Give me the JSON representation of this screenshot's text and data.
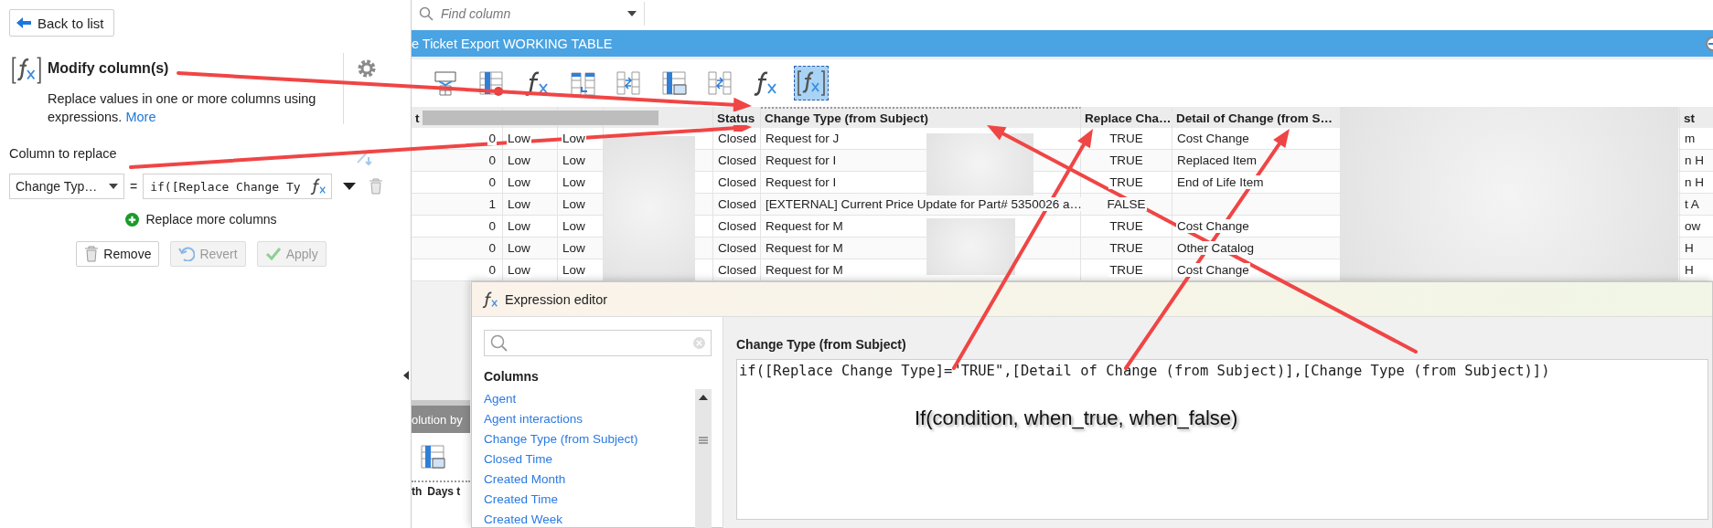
{
  "left_panel": {
    "back_button": "Back to list",
    "title": "Modify column(s)",
    "description": "Replace values in one or more columns using expressions.",
    "more_link": "More",
    "column_label": "Column to replace",
    "column_select": "Change Typ…",
    "equals": "=",
    "expression_value": "if([Replace Change Ty",
    "add_link": "Replace more columns",
    "buttons": [
      {
        "kind": "remove",
        "label": "Remove",
        "disabled": false
      },
      {
        "kind": "revert",
        "label": "Revert",
        "disabled": true
      },
      {
        "kind": "apply",
        "label": "Apply",
        "disabled": true
      }
    ]
  },
  "find_column": {
    "placeholder": "Find column"
  },
  "table_title": "e Ticket Export WORKING TABLE",
  "toolbar": [
    {
      "kind": "ab",
      "selected": false
    },
    {
      "kind": "column-remove",
      "selected": false
    },
    {
      "kind": "fx",
      "selected": false
    },
    {
      "kind": "columns-move",
      "selected": false
    },
    {
      "kind": "split",
      "selected": false
    },
    {
      "kind": "table-window",
      "selected": false
    },
    {
      "kind": "split",
      "selected": false
    },
    {
      "kind": "fx",
      "selected": false
    },
    {
      "kind": "bracket-fx",
      "selected": true
    }
  ],
  "table": {
    "columns": [
      {
        "label": "t",
        "highlighted": false
      },
      {
        "highlighted": false
      },
      {
        "highlighted": false
      },
      {
        "highlighted": false
      },
      {
        "label": "Status",
        "highlighted": false
      },
      {
        "label": "Change Type (from Subject)",
        "highlighted": true
      },
      {
        "label": "Replace Cha…",
        "highlighted": false
      },
      {
        "label": "Detail of Change (from S…",
        "highlighted": false
      },
      {
        "highlighted": false
      },
      {
        "label": "st",
        "highlighted": false
      }
    ],
    "rows": [
      [
        "0",
        "Low",
        "Low",
        null,
        "Closed",
        "Request for J",
        "TRUE",
        "Cost Change",
        null,
        "m"
      ],
      [
        "0",
        "Low",
        "Low",
        null,
        "Closed",
        "Request for I",
        "TRUE",
        "Replaced Item",
        null,
        "n H"
      ],
      [
        "0",
        "Low",
        "Low",
        null,
        "Closed",
        "Request for I",
        "TRUE",
        "End of Life Item",
        null,
        "n H"
      ],
      [
        "1",
        "Low",
        "Low",
        null,
        "Closed",
        "[EXTERNAL] Current Price Update for Part# 5350026 a…",
        "FALSE",
        null,
        null,
        "t A"
      ],
      [
        "0",
        "Low",
        "Low",
        null,
        "Closed",
        "Request for M",
        "TRUE",
        "Cost Change",
        null,
        "ow"
      ],
      [
        "0",
        "Low",
        "Low",
        null,
        "Closed",
        "Request for M",
        "TRUE",
        "Other Catalog",
        null,
        "H"
      ],
      [
        "0",
        "Low",
        "Low",
        null,
        "Closed",
        "Request for M",
        "TRUE",
        "Cost Change",
        null,
        "H"
      ]
    ]
  },
  "lower_panel": {
    "title": "olution by",
    "columns": [
      "th",
      "Days t"
    ]
  },
  "expression_editor": {
    "title": "Expression editor",
    "columns_heading": "Columns",
    "columns": [
      "Agent",
      "Agent interactions",
      "Change Type (from Subject)",
      "Closed Time",
      "Created Month",
      "Created Time",
      "Created Week"
    ],
    "target_column": "Change Type (from Subject)",
    "expression": "if([Replace Change Type]=\"TRUE\",[Detail of Change (from Subject)],[Change Type (from Subject)])",
    "annotation": "If(condition, when_true, when_false)"
  }
}
